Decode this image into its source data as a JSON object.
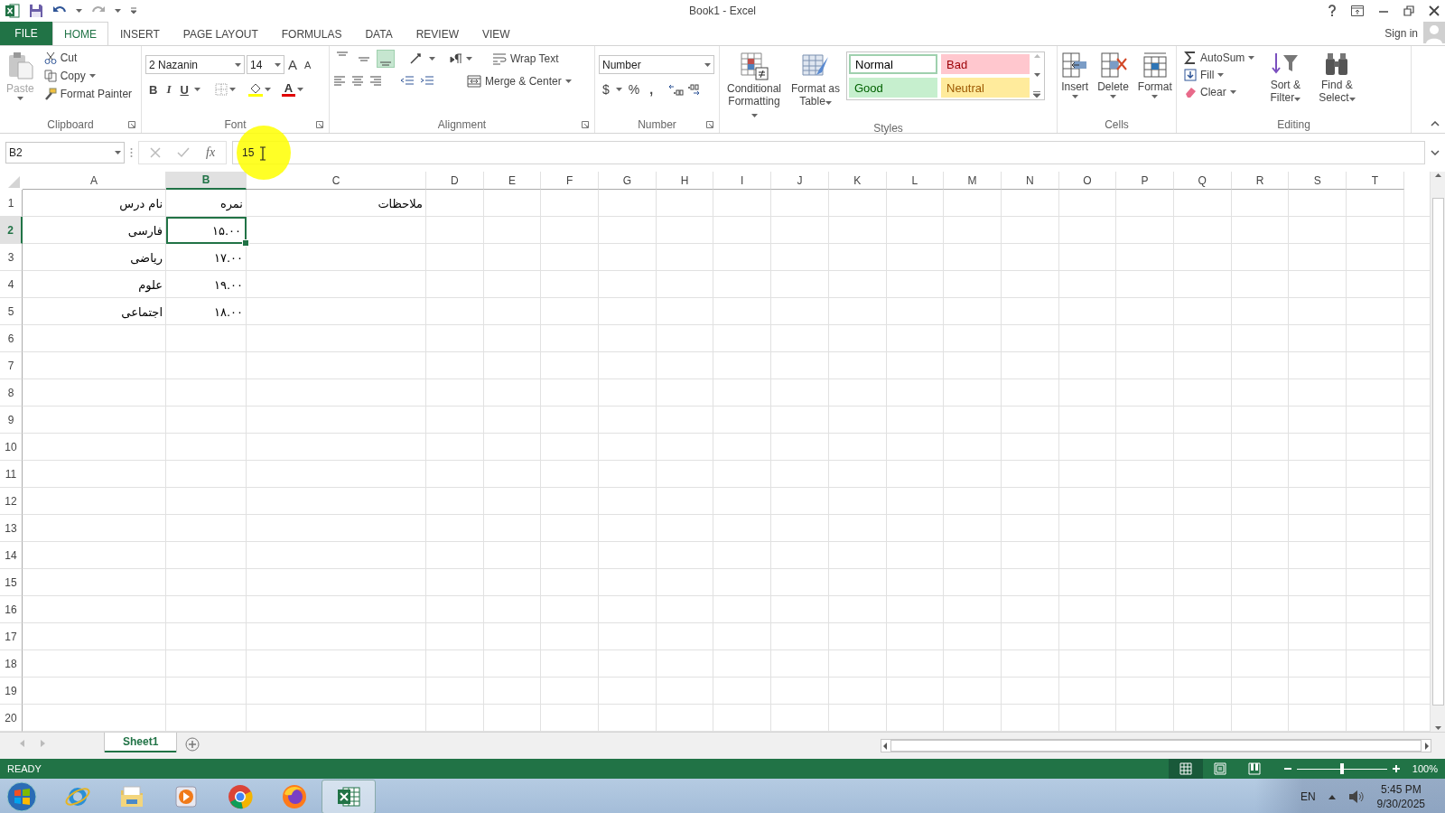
{
  "window": {
    "title": "Book1 - Excel"
  },
  "file_tab": "FILE",
  "tabs": [
    {
      "label": "HOME",
      "selected": true
    },
    {
      "label": "INSERT",
      "selected": false
    },
    {
      "label": "PAGE LAYOUT",
      "selected": false
    },
    {
      "label": "FORMULAS",
      "selected": false
    },
    {
      "label": "DATA",
      "selected": false
    },
    {
      "label": "REVIEW",
      "selected": false
    },
    {
      "label": "VIEW",
      "selected": false
    }
  ],
  "account": {
    "sign_in": "Sign in"
  },
  "clipboard": {
    "label": "Clipboard",
    "paste": {
      "label": "Paste",
      "disabled": true
    },
    "cut": "Cut",
    "copy": "Copy",
    "format_painter": "Format Painter"
  },
  "font": {
    "label": "Font",
    "name": "2  Nazanin",
    "size": "14",
    "grow": "A",
    "shrink": "A",
    "bold": "B",
    "italic": "I",
    "underline": "U",
    "font_color": "A"
  },
  "alignment": {
    "label": "Alignment",
    "vertical": [
      {
        "selected": false
      },
      {
        "selected": false
      },
      {
        "selected": true
      }
    ],
    "wrap_text": "Wrap Text",
    "merge_center": "Merge & Center"
  },
  "number": {
    "label": "Number",
    "format": "Number",
    "currency": "$",
    "percent": "%",
    "comma": ","
  },
  "styles": {
    "label": "Styles",
    "conditional_formatting": "Conditional Formatting",
    "format_as_table": "Format as Table",
    "cell_styles": [
      {
        "name": "Normal",
        "kind": "normal",
        "selected": true
      },
      {
        "name": "Bad",
        "kind": "bad",
        "selected": false
      },
      {
        "name": "Good",
        "kind": "good",
        "selected": false
      },
      {
        "name": "Neutral",
        "kind": "neutral",
        "selected": false
      }
    ]
  },
  "cells_group": {
    "label": "Cells",
    "buttons": [
      {
        "label": "Insert",
        "kind": "insert"
      },
      {
        "label": "Delete",
        "kind": "delete"
      },
      {
        "label": "Format",
        "kind": "format"
      }
    ]
  },
  "editing": {
    "label": "Editing",
    "autosum": "AutoSum",
    "fill": "Fill",
    "clear": "Clear",
    "sort_filter": "Sort & Filter",
    "find_select": "Find & Select"
  },
  "formula_bar": {
    "name_box": "B2",
    "function_label": "fx",
    "value": "15"
  },
  "columns": [
    {
      "label": "A",
      "selected": false
    },
    {
      "label": "B",
      "selected": true
    },
    {
      "label": "C",
      "selected": false
    },
    {
      "label": "D",
      "selected": false
    },
    {
      "label": "E",
      "selected": false
    },
    {
      "label": "F",
      "selected": false
    },
    {
      "label": "G",
      "selected": false
    },
    {
      "label": "H",
      "selected": false
    },
    {
      "label": "I",
      "selected": false
    },
    {
      "label": "J",
      "selected": false
    },
    {
      "label": "K",
      "selected": false
    },
    {
      "label": "L",
      "selected": false
    },
    {
      "label": "M",
      "selected": false
    },
    {
      "label": "N",
      "selected": false
    },
    {
      "label": "O",
      "selected": false
    },
    {
      "label": "P",
      "selected": false
    },
    {
      "label": "Q",
      "selected": false
    },
    {
      "label": "R",
      "selected": false
    },
    {
      "label": "S",
      "selected": false
    },
    {
      "label": "T",
      "selected": false
    }
  ],
  "rows": [
    {
      "label": "1",
      "selected": false,
      "cells": [
        {
          "text": "ملاحظات",
          "selected": false
        },
        {
          "text": "نمره",
          "selected": false
        },
        {
          "text": "نام درس",
          "selected": false
        }
      ]
    },
    {
      "label": "2",
      "selected": true,
      "cells": [
        {
          "text": "۱۵.۰۰",
          "selected": true
        },
        {
          "text": "فارسی",
          "selected": false
        }
      ]
    },
    {
      "label": "3",
      "selected": false,
      "cells": [
        {
          "text": "۱۷.۰۰",
          "selected": false
        },
        {
          "text": "ریاضی",
          "selected": false
        }
      ]
    },
    {
      "label": "4",
      "selected": false,
      "cells": [
        {
          "text": "۱۹.۰۰",
          "selected": false
        },
        {
          "text": "علوم",
          "selected": false
        }
      ]
    },
    {
      "label": "5",
      "selected": false,
      "cells": [
        {
          "text": "۱۸.۰۰",
          "selected": false
        },
        {
          "text": "اجتماعی",
          "selected": false
        }
      ]
    },
    {
      "label": "6",
      "selected": false
    },
    {
      "label": "7",
      "selected": false
    },
    {
      "label": "8",
      "selected": false
    },
    {
      "label": "9",
      "selected": false
    },
    {
      "label": "10",
      "selected": false
    },
    {
      "label": "11",
      "selected": false
    },
    {
      "label": "12",
      "selected": false
    },
    {
      "label": "13",
      "selected": false
    },
    {
      "label": "14",
      "selected": false
    },
    {
      "label": "15",
      "selected": false
    },
    {
      "label": "16",
      "selected": false
    },
    {
      "label": "17",
      "selected": false
    },
    {
      "label": "18",
      "selected": false
    },
    {
      "label": "19",
      "selected": false
    },
    {
      "label": "20",
      "selected": false
    }
  ],
  "sheets": [
    {
      "label": "Sheet1",
      "selected": true
    }
  ],
  "status_bar": {
    "status": "READY",
    "views": [
      {
        "kind": "normal",
        "selected": true
      },
      {
        "kind": "page-layout",
        "selected": false
      },
      {
        "kind": "page-break",
        "selected": false
      }
    ],
    "zoom": {
      "level": 0.5,
      "reading": "100%"
    }
  },
  "taskbar": {
    "apps": [
      {
        "kind": "ie",
        "selected": false
      },
      {
        "kind": "explorer",
        "selected": false
      },
      {
        "kind": "media",
        "selected": false
      },
      {
        "kind": "chrome",
        "selected": false
      },
      {
        "kind": "firefox",
        "selected": false
      },
      {
        "kind": "excel",
        "selected": true
      }
    ],
    "language": "EN",
    "time": "5:45 PM",
    "date": "9/30/2025"
  }
}
